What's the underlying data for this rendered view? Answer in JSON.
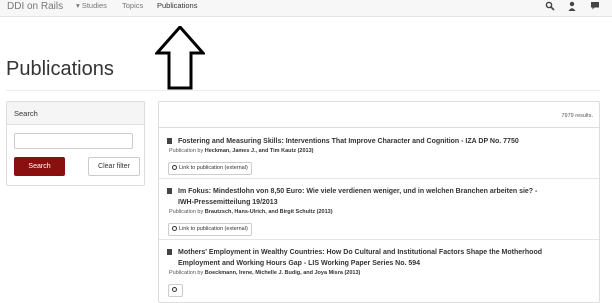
{
  "navbar": {
    "brand": "DDI on Rails",
    "studies": "▾ Studies",
    "topics": "Topics",
    "publications": "Publications"
  },
  "page": {
    "title": "Publications"
  },
  "search": {
    "heading": "Search",
    "value": "",
    "submit": "Search",
    "clear": "Clear filter"
  },
  "results": {
    "count": "7979 results.",
    "items": [
      {
        "title": "Fostering and Measuring Skills: Interventions That Improve Character and Cognition - IZA DP No. 7750",
        "by": "Publication by",
        "authors": "Heckman, James J., and Tim Kautz (2013)",
        "link": "Link to publication (external)"
      },
      {
        "title_line1": "Im Fokus: Mindestlohn von 8,50 Euro: Wie viele verdienen weniger, und in welchen Branchen arbeiten sie? -",
        "title_line2": "IWH-Pressemitteilung 19/2013",
        "by": "Publication by",
        "authors": "Brautzsch, Hans-Ulrich, and Birgit Schultz (2013)",
        "link": "Link to publication (external)"
      },
      {
        "title_line1": "Mothers' Employment in Wealthy Countries: How Do Cultural and Institutional Factors Shape the Motherhood",
        "title_line2": "Employment and Working Hours Gap - LIS Working Paper Series No. 594",
        "by": "Publication by",
        "authors": "Boeckmann, Irene, Michelle J. Budig, and Joya Misra (2013)"
      }
    ]
  }
}
